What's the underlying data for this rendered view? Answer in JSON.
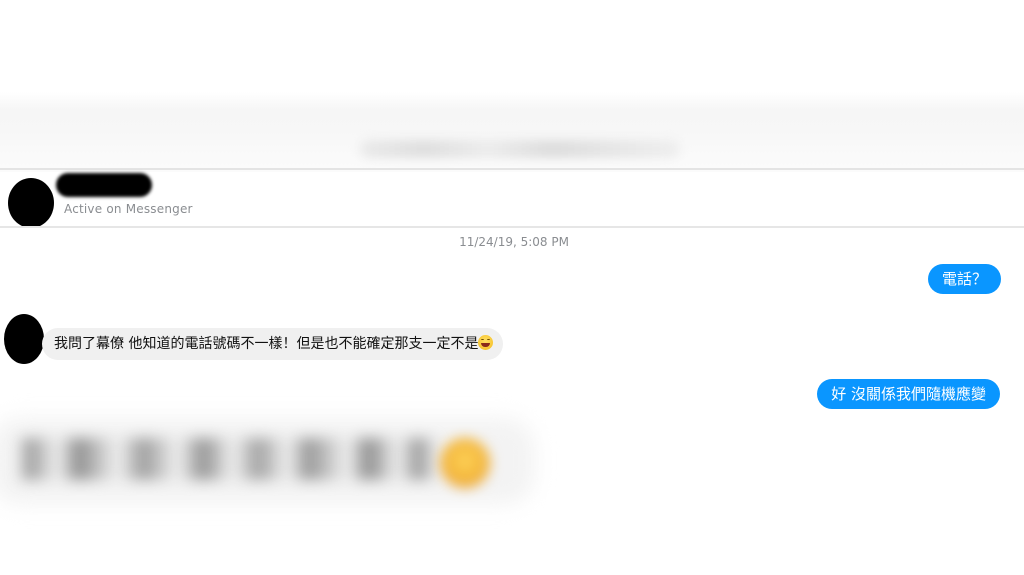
{
  "conversation": {
    "contact": {
      "status": "Active on Messenger"
    },
    "timestamp": "11/24/19, 5:08 PM",
    "messages": [
      {
        "direction": "outgoing",
        "text": "電話？"
      },
      {
        "direction": "incoming",
        "text": "我問了幕僚 他知道的電話號碼不一樣！但是也不能確定那支一定不是",
        "emoji": "grinning-face-icon"
      },
      {
        "direction": "outgoing",
        "text": "好 沒關係我們隨機應變"
      }
    ]
  },
  "colors": {
    "outgoing_bubble": "#0a96ff",
    "incoming_bubble": "#f0f0f0",
    "meta_text": "#8a8d91"
  }
}
